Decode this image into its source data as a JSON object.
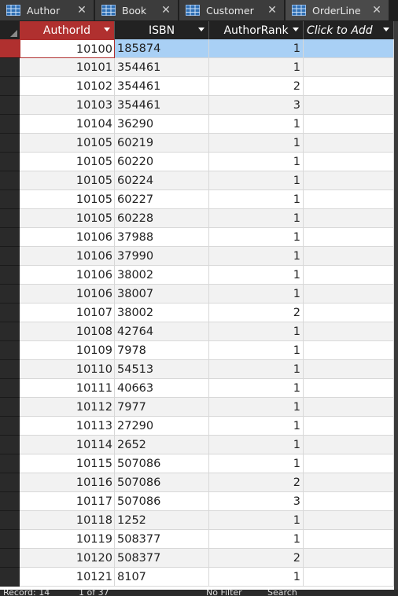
{
  "tabs": [
    {
      "label": "Author",
      "icon": "table-icon",
      "active": false
    },
    {
      "label": "Book",
      "icon": "table-icon",
      "active": false
    },
    {
      "label": "Customer",
      "icon": "table-icon",
      "active": false
    },
    {
      "label": "OrderLine",
      "icon": "table-icon",
      "active": true
    }
  ],
  "columns": [
    "AuthorId",
    "ISBN",
    "AuthorRank",
    "Click to Add"
  ],
  "rows": [
    [
      "10100",
      "185874",
      "1"
    ],
    [
      "10101",
      "354461",
      "1"
    ],
    [
      "10102",
      "354461",
      "2"
    ],
    [
      "10103",
      "354461",
      "3"
    ],
    [
      "10104",
      "36290",
      "1"
    ],
    [
      "10105",
      "60219",
      "1"
    ],
    [
      "10105",
      "60220",
      "1"
    ],
    [
      "10105",
      "60224",
      "1"
    ],
    [
      "10105",
      "60227",
      "1"
    ],
    [
      "10105",
      "60228",
      "1"
    ],
    [
      "10106",
      "37988",
      "1"
    ],
    [
      "10106",
      "37990",
      "1"
    ],
    [
      "10106",
      "38002",
      "1"
    ],
    [
      "10106",
      "38007",
      "1"
    ],
    [
      "10107",
      "38002",
      "2"
    ],
    [
      "10108",
      "42764",
      "1"
    ],
    [
      "10109",
      "7978",
      "1"
    ],
    [
      "10110",
      "54513",
      "1"
    ],
    [
      "10111",
      "40663",
      "1"
    ],
    [
      "10112",
      "7977",
      "1"
    ],
    [
      "10113",
      "27290",
      "1"
    ],
    [
      "10114",
      "2652",
      "1"
    ],
    [
      "10115",
      "507086",
      "1"
    ],
    [
      "10116",
      "507086",
      "2"
    ],
    [
      "10117",
      "507086",
      "3"
    ],
    [
      "10118",
      "1252",
      "1"
    ],
    [
      "10119",
      "508377",
      "1"
    ],
    [
      "10120",
      "508377",
      "2"
    ],
    [
      "10121",
      "8107",
      "1"
    ]
  ],
  "nav": {
    "record_label": "Record: 14",
    "position": "1 of 37",
    "filter": "No Filter",
    "search": "Search"
  },
  "colors": {
    "accent": "#b0302f",
    "selected_row": "#a9d0f5"
  }
}
